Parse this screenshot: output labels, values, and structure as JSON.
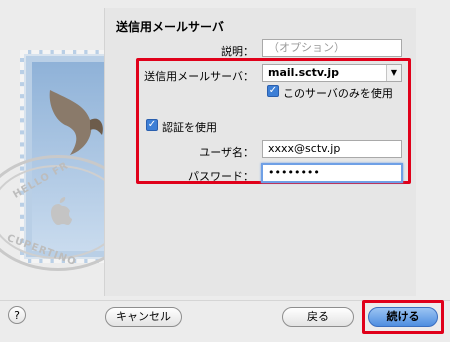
{
  "section": {
    "title": "送信用メールサーバ"
  },
  "description": {
    "label": "説明：",
    "placeholder": "（オプション）"
  },
  "server": {
    "label": "送信用メールサーバ：",
    "value": "mail.sctv.jp",
    "only_this_label": "このサーバのみを使用"
  },
  "auth": {
    "label": "認証を使用"
  },
  "username": {
    "label": "ユーザ名：",
    "value": "xxxx@sctv.jp"
  },
  "password": {
    "label": "パスワード：",
    "value": "••••••••"
  },
  "buttons": {
    "cancel": "キャンセル",
    "back": "戻る",
    "continue": "続ける",
    "help": "?"
  },
  "art": {
    "postmark_top": "HELLO FR",
    "postmark_bottom": "CUPERTINO"
  },
  "colors": {
    "highlight": "#e0001a",
    "accent": "#3d7fd6"
  }
}
